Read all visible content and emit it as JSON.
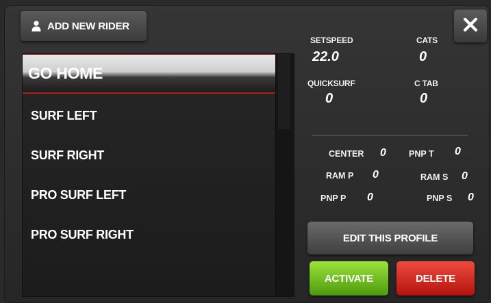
{
  "header": {
    "add_rider_label": "ADD NEW RIDER",
    "close_label": "×"
  },
  "riders": [
    {
      "label": "GO HOME",
      "selected": true
    },
    {
      "label": "SURF LEFT",
      "selected": false
    },
    {
      "label": "SURF RIGHT",
      "selected": false
    },
    {
      "label": "PRO SURF LEFT",
      "selected": false
    },
    {
      "label": "PRO SURF RIGHT",
      "selected": false
    }
  ],
  "stats": {
    "setspeed_label": "SETSPEED",
    "setspeed_value": "22.0",
    "cats_label": "CATS",
    "cats_value": "0",
    "quicksurf_label": "QUICKSURF",
    "quicksurf_value": "0",
    "ctab_label": "C TAB",
    "ctab_value": "0"
  },
  "mini_stats": {
    "center_label": "CENTER",
    "center_value": "0",
    "pnpt_label": "PNP T",
    "pnpt_value": "0",
    "ramp_label": "RAM P",
    "ramp_value": "0",
    "rams_label": "RAM S",
    "rams_value": "0",
    "pnpp_label": "PNP P",
    "pnpp_value": "0",
    "pnps_label": "PNP S",
    "pnps_value": "0"
  },
  "actions": {
    "edit_label": "EDIT THIS PROFILE",
    "activate_label": "ACTIVATE",
    "delete_label": "DELETE"
  },
  "colors": {
    "selected_border": "#c01818",
    "activate": "#6fc121",
    "delete": "#d6261f"
  },
  "icons": {
    "add_rider": "person-icon",
    "close": "close-icon"
  }
}
